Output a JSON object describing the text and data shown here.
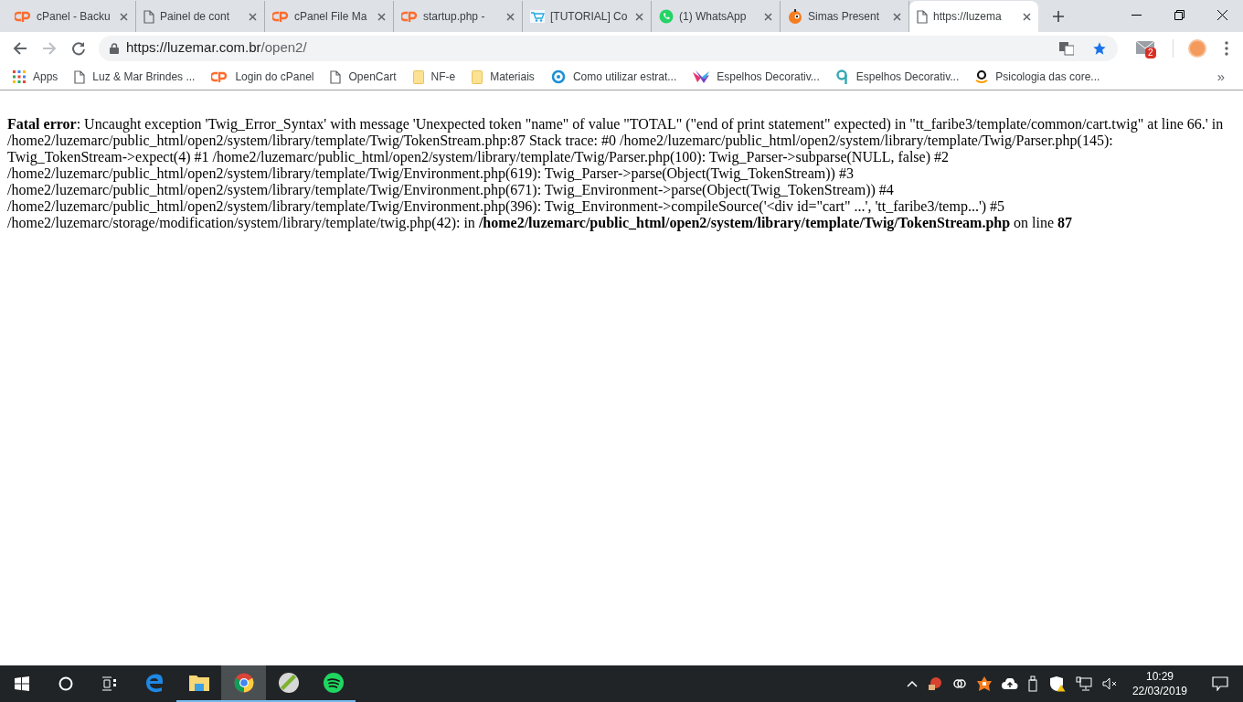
{
  "tabs": [
    {
      "kind": "cpanel",
      "title": "cPanel - Backu",
      "selected": false
    },
    {
      "kind": "page",
      "title": "Painel de cont",
      "selected": false
    },
    {
      "kind": "cpanel",
      "title": "cPanel File Ma",
      "selected": false
    },
    {
      "kind": "cpanel",
      "title": "startup.php - ",
      "selected": false
    },
    {
      "kind": "cart",
      "title": "[TUTORIAL] Co",
      "selected": false
    },
    {
      "kind": "whatsapp",
      "title": "(1) WhatsApp",
      "selected": false
    },
    {
      "kind": "pumpkin",
      "title": "Simas Present",
      "selected": false
    },
    {
      "kind": "page",
      "title": "https://luzema",
      "selected": true
    }
  ],
  "address": {
    "host": "https://luzemar.com.br",
    "path": "/open2/",
    "bookmarked": true
  },
  "mail_badge": "2",
  "bookmarks": [
    {
      "kind": "apps",
      "label": "Apps"
    },
    {
      "kind": "page",
      "label": "Luz & Mar Brindes ..."
    },
    {
      "kind": "cpanel",
      "label": "Login do cPanel"
    },
    {
      "kind": "page",
      "label": "OpenCart"
    },
    {
      "kind": "folder",
      "label": "NF-e"
    },
    {
      "kind": "folder",
      "label": "Materiais"
    },
    {
      "kind": "target",
      "label": "Como utilizar estrat..."
    },
    {
      "kind": "bird",
      "label": "Espelhos Decorativ..."
    },
    {
      "kind": "q",
      "label": "Espelhos Decorativ..."
    },
    {
      "kind": "amazon",
      "label": "Psicologia das core..."
    }
  ],
  "more_bookmarks": "»",
  "error": "**Fatal error**: Uncaught exception 'Twig_Error_Syntax' with message 'Unexpected token \"name\" of value \"TOTAL\" (\"end of print statement\" expected) in \"tt_faribe3/template/common/cart.twig\" at line 66.' in /home2/luzemarc/public_html/open2/system/library/template/Twig/TokenStream.php:87 Stack trace: #0 /home2/luzemarc/public_html/open2/system/library/template/Twig/Parser.php(145): Twig_TokenStream->expect(4) #1 /home2/luzemarc/public_html/open2/system/library/template/Twig/Parser.php(100): Twig_Parser->subparse(NULL, false) #2 /home2/luzemarc/public_html/open2/system/library/template/Twig/Environment.php(619): Twig_Parser->parse(Object(Twig_TokenStream)) #3 /home2/luzemarc/public_html/open2/system/library/template/Twig/Environment.php(671): Twig_Environment->parse(Object(Twig_TokenStream)) #4 /home2/luzemarc/public_html/open2/system/library/template/Twig/Environment.php(396): Twig_Environment->compileSource('<div id=\"cart\" ...', 'tt_faribe3/temp...') #5 /home2/luzemarc/storage/modification/system/library/template/twig.php(42): in **/home2/luzemarc/public_html/open2/system/library/template/Twig/TokenStream.php** on line **87**",
  "taskbar": {
    "apps": [
      {
        "kind": "edge",
        "running": false,
        "selected": false
      },
      {
        "kind": "explorer",
        "running": true,
        "selected": false
      },
      {
        "kind": "chrome",
        "running": true,
        "selected": true
      },
      {
        "kind": "greenball",
        "running": true,
        "selected": false
      },
      {
        "kind": "spotify",
        "running": true,
        "selected": false
      }
    ],
    "time": "10:29",
    "date": "22/03/2019"
  }
}
